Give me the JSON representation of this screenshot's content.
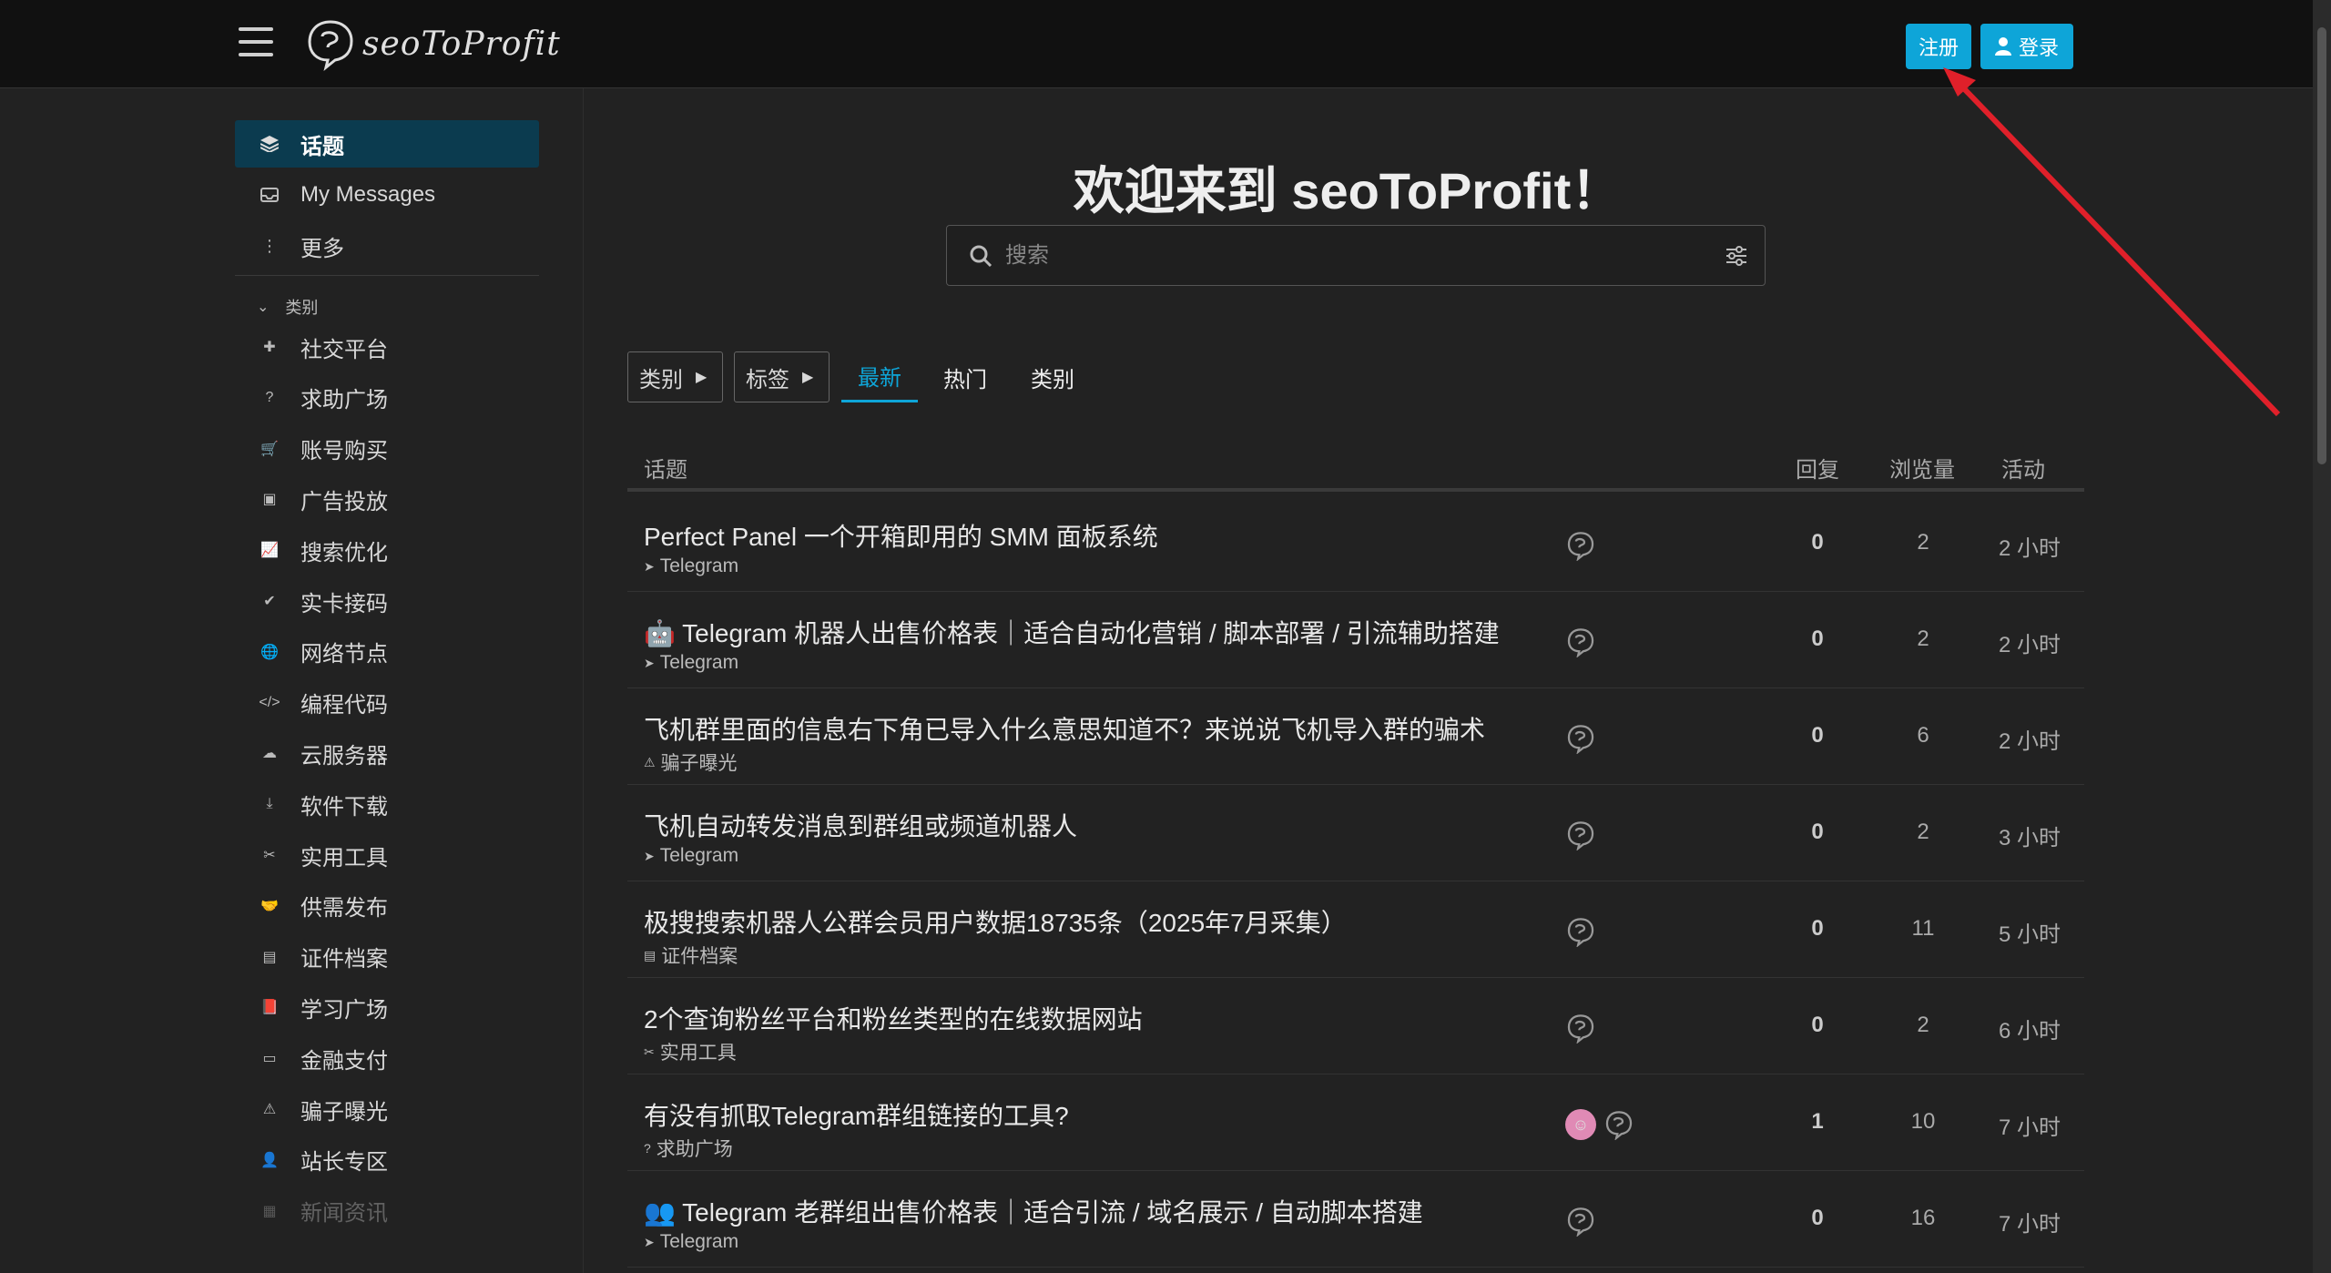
{
  "header": {
    "logo_text": "seoToProfit",
    "signup_label": "注册",
    "login_label": "登录"
  },
  "sidebar": {
    "primary": [
      {
        "label": "话题",
        "icon": "layers-icon"
      },
      {
        "label": "My Messages",
        "icon": "inbox-icon"
      },
      {
        "label": "更多",
        "icon": "more-vertical-icon"
      }
    ],
    "categories_header": "类别",
    "categories": [
      {
        "label": "社交平台",
        "icon": "puzzle-icon"
      },
      {
        "label": "求助广场",
        "icon": "question-icon"
      },
      {
        "label": "账号购买",
        "icon": "cart-icon"
      },
      {
        "label": "广告投放",
        "icon": "image-icon"
      },
      {
        "label": "搜索优化",
        "icon": "chart-line-icon"
      },
      {
        "label": "实卡接码",
        "icon": "check-circle-icon"
      },
      {
        "label": "网络节点",
        "icon": "globe-icon"
      },
      {
        "label": "编程代码",
        "icon": "code-icon"
      },
      {
        "label": "云服务器",
        "icon": "cloud-icon"
      },
      {
        "label": "软件下载",
        "icon": "download-icon"
      },
      {
        "label": "实用工具",
        "icon": "tools-icon"
      },
      {
        "label": "供需发布",
        "icon": "handshake-icon"
      },
      {
        "label": "证件档案",
        "icon": "id-card-icon"
      },
      {
        "label": "学习广场",
        "icon": "book-icon"
      },
      {
        "label": "金融支付",
        "icon": "credit-card-icon"
      },
      {
        "label": "骗子曝光",
        "icon": "warning-icon"
      },
      {
        "label": "站长专区",
        "icon": "user-gear-icon"
      },
      {
        "label": "新闻资讯",
        "icon": "news-icon"
      }
    ]
  },
  "main": {
    "welcome": "欢迎来到 seoToProfit！",
    "search_placeholder": "搜索",
    "nav": {
      "categories_dropdown": "类别",
      "tags_dropdown": "标签",
      "tabs": [
        "最新",
        "热门",
        "类别"
      ]
    },
    "table_headers": {
      "topic": "话题",
      "replies": "回复",
      "views": "浏览量",
      "activity": "活动"
    },
    "topics": [
      {
        "title": "Perfect Panel 一个开箱即用的 SMM 面板系统",
        "category": "Telegram",
        "cat_icon": "telegram-icon",
        "replies": "0",
        "views": "2",
        "activity": "2 小时",
        "avatars": 1
      },
      {
        "title": "🤖 Telegram 机器人出售价格表｜适合自动化营销 / 脚本部署 / 引流辅助搭建",
        "category": "Telegram",
        "cat_icon": "telegram-icon",
        "replies": "0",
        "views": "2",
        "activity": "2 小时",
        "avatars": 1
      },
      {
        "title": "飞机群里面的信息右下角已导入什么意思知道不？来说说飞机导入群的骗术",
        "category": "骗子曝光",
        "cat_icon": "warning-icon",
        "replies": "0",
        "views": "6",
        "activity": "2 小时",
        "avatars": 1
      },
      {
        "title": "飞机自动转发消息到群组或频道机器人",
        "category": "Telegram",
        "cat_icon": "telegram-icon",
        "replies": "0",
        "views": "2",
        "activity": "3 小时",
        "avatars": 1
      },
      {
        "title": "极搜搜索机器人公群会员用户数据18735条（2025年7月采集）",
        "category": "证件档案",
        "cat_icon": "id-card-icon",
        "replies": "0",
        "views": "11",
        "activity": "5 小时",
        "avatars": 1
      },
      {
        "title": "2个查询粉丝平台和粉丝类型的在线数据网站",
        "category": "实用工具",
        "cat_icon": "tools-icon",
        "replies": "0",
        "views": "2",
        "activity": "6 小时",
        "avatars": 1
      },
      {
        "title": "有没有抓取Telegram群组链接的工具?",
        "category": "求助广场",
        "cat_icon": "question-icon",
        "replies": "1",
        "views": "10",
        "activity": "7 小时",
        "avatars": 2
      },
      {
        "title": "👥 Telegram 老群组出售价格表｜适合引流 / 域名展示 / 自动脚本搭建",
        "category": "Telegram",
        "cat_icon": "telegram-icon",
        "replies": "0",
        "views": "16",
        "activity": "7 小时",
        "avatars": 1
      }
    ]
  }
}
